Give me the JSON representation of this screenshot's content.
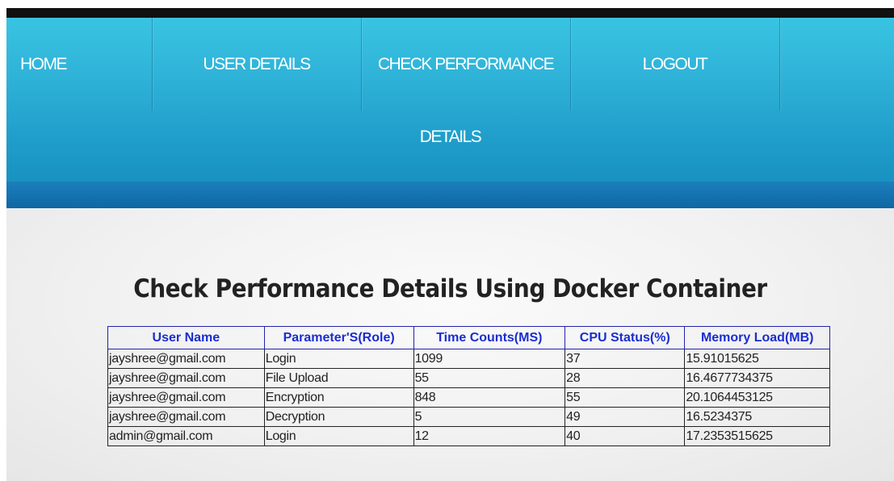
{
  "nav": {
    "items": [
      {
        "label": "HOME"
      },
      {
        "label": "USER DETAILS"
      },
      {
        "label": "CHECK PERFORMANCE"
      },
      {
        "label": "LOGOUT"
      },
      {
        "label": "DETAILS"
      }
    ]
  },
  "main": {
    "title": "Check Performance Details Using Docker Container"
  },
  "table": {
    "headers": [
      "User Name",
      "Parameter'S(Role)",
      "Time Counts(MS)",
      "CPU Status(%)",
      "Memory Load(MB)"
    ],
    "rows": [
      [
        "jayshree@gmail.com",
        "Login",
        "1099",
        "37",
        "15.91015625"
      ],
      [
        "jayshree@gmail.com",
        "File Upload",
        "55",
        "28",
        "16.4677734375"
      ],
      [
        "jayshree@gmail.com",
        "Encryption",
        "848",
        "55",
        "20.1064453125"
      ],
      [
        "jayshree@gmail.com",
        "Decryption",
        "5",
        "49",
        "16.5234375"
      ],
      [
        "admin@gmail.com",
        "Login",
        "12",
        "40",
        "17.2353515625"
      ]
    ]
  },
  "colors": {
    "nav_top": "#39c4e2",
    "nav_bottom": "#1892c1",
    "strip": "#1573b0",
    "header_text": "#1a2dd1"
  }
}
